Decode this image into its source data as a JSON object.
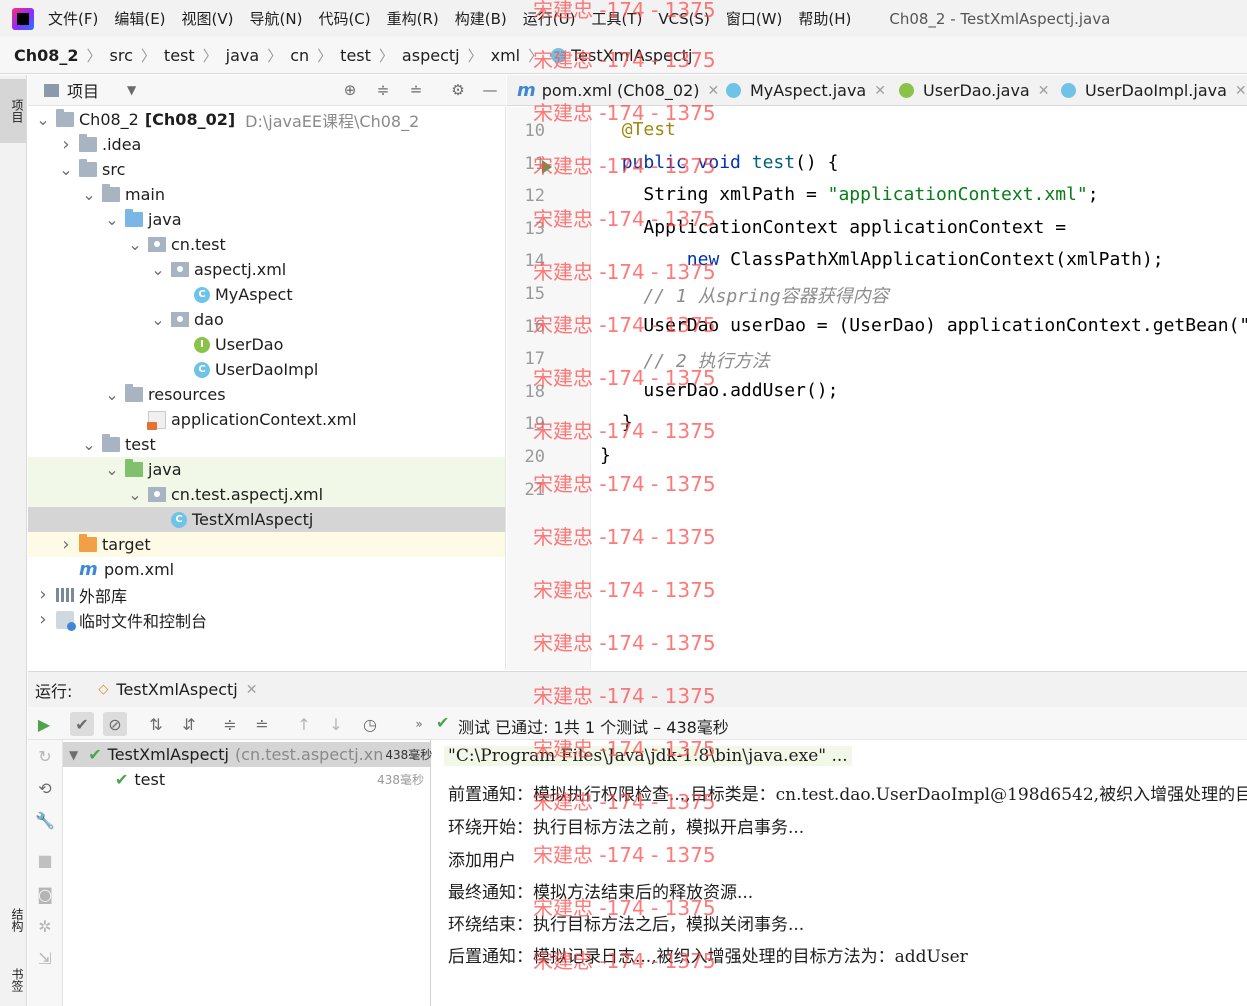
{
  "menubar": {
    "items": [
      "文件(F)",
      "编辑(E)",
      "视图(V)",
      "导航(N)",
      "代码(C)",
      "重构(R)",
      "构建(B)",
      "运行(U)",
      "工具(T)",
      "VCS(S)",
      "窗口(W)",
      "帮助(H)"
    ],
    "window_title": "Ch08_2 - TestXmlAspectj.java"
  },
  "breadcrumb": [
    "Ch08_2",
    "src",
    "test",
    "java",
    "cn",
    "test",
    "aspectj",
    "xml",
    "TestXmlAspectj"
  ],
  "left_strip": {
    "top_tab": "项目",
    "bottom_tab_1": "结构",
    "bottom_tab_2": "书签"
  },
  "project_panel": {
    "title": "项目",
    "tree": [
      {
        "label": "Ch08_2",
        "bold_part": "[Ch08_02]",
        "path": "D:\\javaEE课程\\Ch08_2",
        "icon": "module-icon",
        "depth": 0,
        "arrow": "down"
      },
      {
        "label": ".idea",
        "icon": "folder-icon",
        "depth": 1,
        "arrow": "right"
      },
      {
        "label": "src",
        "icon": "folder-icon",
        "depth": 1,
        "arrow": "down"
      },
      {
        "label": "main",
        "icon": "folder-icon",
        "depth": 2,
        "arrow": "down"
      },
      {
        "label": "java",
        "icon": "source-folder-icon",
        "depth": 3,
        "arrow": "down"
      },
      {
        "label": "cn.test",
        "icon": "package-icon",
        "depth": 4,
        "arrow": "down"
      },
      {
        "label": "aspectj.xml",
        "icon": "package-icon",
        "depth": 5,
        "arrow": "down"
      },
      {
        "label": "MyAspect",
        "icon": "class-icon",
        "depth": 6,
        "arrow": "none"
      },
      {
        "label": "dao",
        "icon": "package-icon",
        "depth": 5,
        "arrow": "down"
      },
      {
        "label": "UserDao",
        "icon": "interface-icon",
        "depth": 6,
        "arrow": "none"
      },
      {
        "label": "UserDaoImpl",
        "icon": "class-icon",
        "depth": 6,
        "arrow": "none"
      },
      {
        "label": "resources",
        "icon": "resources-folder-icon",
        "depth": 3,
        "arrow": "down"
      },
      {
        "label": "applicationContext.xml",
        "icon": "xml-file-icon",
        "depth": 4,
        "arrow": "none"
      },
      {
        "label": "test",
        "icon": "folder-icon",
        "depth": 2,
        "arrow": "down"
      },
      {
        "label": "java",
        "icon": "test-source-folder-icon",
        "depth": 3,
        "arrow": "down",
        "highlight": "green"
      },
      {
        "label": "cn.test.aspectj.xml",
        "icon": "package-icon",
        "depth": 4,
        "arrow": "down",
        "highlight": "green"
      },
      {
        "label": "TestXmlAspectj",
        "icon": "test-class-icon",
        "depth": 5,
        "arrow": "none",
        "highlight": "selected"
      },
      {
        "label": "target",
        "icon": "excluded-folder-icon",
        "depth": 1,
        "arrow": "right",
        "highlight": "yellow"
      },
      {
        "label": "pom.xml",
        "icon": "maven-icon",
        "depth": 1,
        "arrow": "none"
      },
      {
        "label": "外部库",
        "icon": "library-icon",
        "depth": 0,
        "arrow": "right"
      },
      {
        "label": "临时文件和控制台",
        "icon": "scratch-icon",
        "depth": 0,
        "arrow": "right"
      }
    ]
  },
  "editor": {
    "tabs": [
      {
        "label": "pom.xml (Ch08_02)",
        "icon": "maven-icon"
      },
      {
        "label": "MyAspect.java",
        "icon": "class-icon"
      },
      {
        "label": "UserDao.java",
        "icon": "interface-icon"
      },
      {
        "label": "UserDaoImpl.java",
        "icon": "class-icon"
      }
    ],
    "lines": [
      {
        "n": "10",
        "indent": 2,
        "tokens": [
          {
            "t": "@Test",
            "c": "ann"
          }
        ]
      },
      {
        "n": "11",
        "indent": 2,
        "tokens": [
          {
            "t": "public ",
            "c": "kw"
          },
          {
            "t": "void ",
            "c": "kw"
          },
          {
            "t": "test",
            "c": "fn"
          },
          {
            "t": "() {",
            "c": ""
          }
        ]
      },
      {
        "n": "12",
        "indent": 4,
        "tokens": [
          {
            "t": "String xmlPath = ",
            "c": ""
          },
          {
            "t": "\"applicationContext.xml\"",
            "c": "str"
          },
          {
            "t": ";",
            "c": ""
          }
        ]
      },
      {
        "n": "13",
        "indent": 4,
        "tokens": [
          {
            "t": "ApplicationContext applicationContext =",
            "c": ""
          }
        ]
      },
      {
        "n": "14",
        "indent": 8,
        "tokens": [
          {
            "t": "new ",
            "c": "kw"
          },
          {
            "t": "ClassPathXmlApplicationContext(xmlPath);",
            "c": ""
          }
        ]
      },
      {
        "n": "15",
        "indent": 4,
        "tokens": [
          {
            "t": "// 1 从spring容器获得内容",
            "c": "cmt"
          }
        ]
      },
      {
        "n": "16",
        "indent": 4,
        "tokens": [
          {
            "t": "UserDao userDao = (UserDao) applicationContext.getBean(\"userDao\");",
            "c": ""
          }
        ]
      },
      {
        "n": "17",
        "indent": 4,
        "tokens": [
          {
            "t": "// 2 执行方法",
            "c": "cmt"
          }
        ]
      },
      {
        "n": "18",
        "indent": 4,
        "tokens": [
          {
            "t": "userDao.addUser();",
            "c": ""
          }
        ]
      },
      {
        "n": "19",
        "indent": 2,
        "tokens": [
          {
            "t": "}",
            "c": ""
          }
        ]
      },
      {
        "n": "20",
        "indent": 0,
        "tokens": [
          {
            "t": "}",
            "c": ""
          }
        ]
      },
      {
        "n": "21",
        "indent": 0,
        "tokens": []
      }
    ]
  },
  "run": {
    "label": "运行:",
    "tab": "TestXmlAspectj",
    "status": "测试 已通过: 1共 1 个测试 – 438毫秒",
    "tree": [
      {
        "label": "TestXmlAspectj",
        "sub": "(cn.test.aspectj.xn",
        "time": "438毫秒"
      },
      {
        "label": "test",
        "sub": "",
        "time": "438毫秒"
      }
    ],
    "console": [
      "\"C:\\Program Files\\Java\\jdk-1.8\\bin\\java.exe\" ...",
      "前置通知：模拟执行权限检查...,目标类是：cn.test.dao.UserDaoImpl@198d6542,被织入增强处理的目标方法为：addUser",
      "环绕开始：执行目标方法之前，模拟开启事务...",
      "添加用户",
      "最终通知：模拟方法结束后的释放资源...",
      "环绕结束：执行目标方法之后，模拟关闭事务...",
      "后置通知：模拟记录日志...,被织入增强处理的目标方法为：addUser"
    ]
  },
  "watermark": "宋建忠 -174 - 1375",
  "colors": {
    "keyword": "#0033b3",
    "string": "#067d17",
    "annotation": "#9e880d",
    "comment": "#8c8c8c",
    "pass": "#4ea24e",
    "watermark": "#ff4d4d"
  }
}
